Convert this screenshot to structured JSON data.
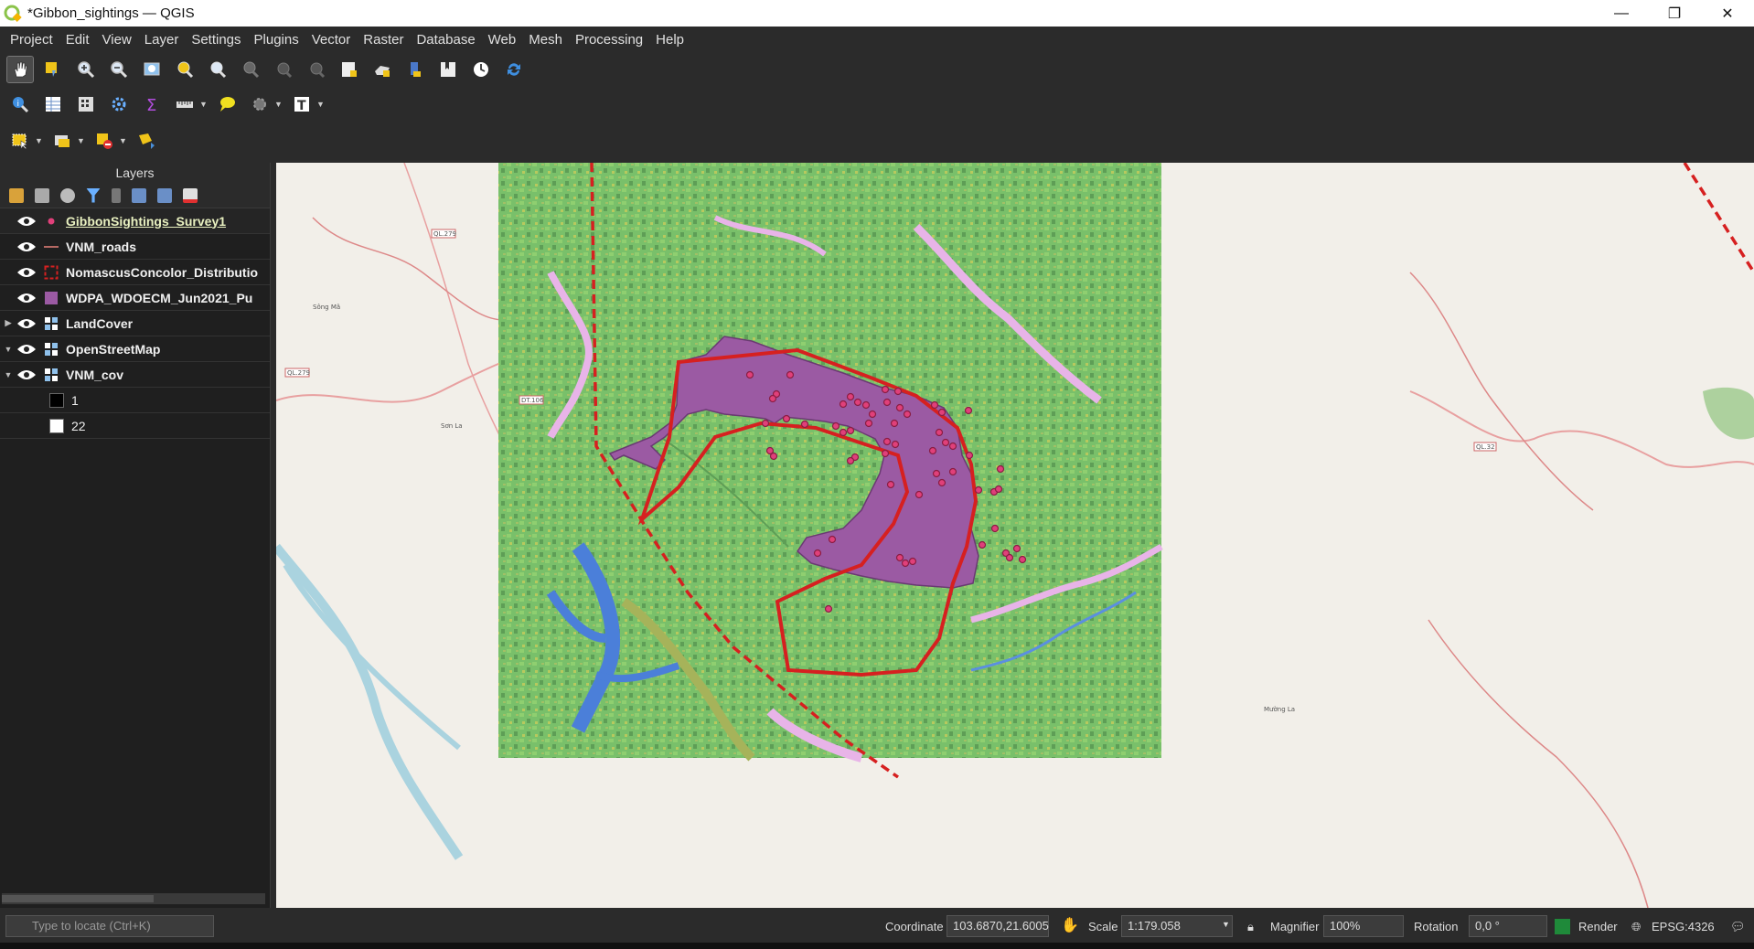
{
  "window": {
    "title": "*Gibbon_sightings — QGIS",
    "minimize": "—",
    "maximize": "❐",
    "close": "✕"
  },
  "menu": [
    "Project",
    "Edit",
    "View",
    "Layer",
    "Settings",
    "Plugins",
    "Vector",
    "Raster",
    "Database",
    "Web",
    "Mesh",
    "Processing",
    "Help"
  ],
  "toolbar1": [
    "pan-map-icon",
    "pan-to-selection-icon",
    "zoom-in-icon",
    "zoom-out-icon",
    "zoom-full-icon",
    "zoom-to-selection-icon",
    "zoom-to-layer-icon",
    "zoom-native-icon",
    "zoom-last-icon",
    "zoom-next-icon",
    "new-bookmark-icon",
    "show-bookmarks-icon",
    "new-map-view-icon",
    "spatial-bookmark-icon",
    "temporal-controller-icon",
    "refresh-icon"
  ],
  "toolbar2": [
    "identify-icon",
    "attribute-table-icon",
    "field-calculator-icon",
    "toolbox-icon",
    "statistics-icon",
    "measure-icon",
    "map-tips-icon",
    "actions-icon",
    "text-annotation-icon"
  ],
  "toolbar3": [
    "select-features-icon",
    "select-by-value-icon",
    "deselect-icon",
    "select-location-icon"
  ],
  "layers_panel": {
    "title": "Layers",
    "layers": [
      {
        "name": "GibbonSightings_Survey1",
        "symbol": "point",
        "color": "#e0407a",
        "expand": ""
      },
      {
        "name": "VNM_roads",
        "symbol": "line",
        "color": "#e8827a",
        "expand": ""
      },
      {
        "name": "NomascusConcolor_Distributio",
        "symbol": "dashed-polygon",
        "color": "#d62020",
        "expand": ""
      },
      {
        "name": "WDPA_WDOECM_Jun2021_Pu",
        "symbol": "polygon",
        "color": "#9b5aa3",
        "expand": ""
      },
      {
        "name": "LandCover",
        "symbol": "raster",
        "color": "#ffffff",
        "expand": "▶"
      },
      {
        "name": "OpenStreetMap",
        "symbol": "raster",
        "color": "#ffffff",
        "expand": "▼"
      },
      {
        "name": "VNM_cov",
        "symbol": "raster",
        "color": "#ffffff",
        "expand": "▼"
      }
    ],
    "legend": [
      {
        "label": "1",
        "color": "#000000"
      },
      {
        "label": "22",
        "color": "#ffffff"
      }
    ]
  },
  "map_labels": [
    "QL.279",
    "QL.279",
    "DT.106",
    "QL.32",
    "Sơn La",
    "Mường La",
    "Sông Mã"
  ],
  "status": {
    "locate_placeholder": "Type to locate (Ctrl+K)",
    "coordinate_label": "Coordinate",
    "coordinate_value": "103.6870,21.6005",
    "scale_label": "Scale",
    "scale_value": "1:179.058",
    "magnifier_label": "Magnifier",
    "magnifier_value": "100%",
    "rotation_label": "Rotation",
    "rotation_value": "0,0 °",
    "render_label": "Render",
    "crs": "EPSG:4326"
  }
}
